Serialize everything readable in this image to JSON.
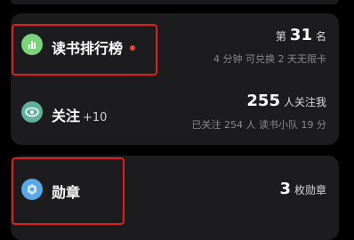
{
  "leaderboard": {
    "title": "读书排行榜",
    "rank_prefix": "第",
    "rank_value": "31",
    "rank_suffix": "名",
    "subtext": "4 分钟 可兑换 2 天无限卡",
    "accent_color": "#7bd47a",
    "icon": "bar-chart-icon"
  },
  "follow": {
    "title": "关注",
    "title_suffix": "+10",
    "followers_value": "255",
    "followers_suffix": "人关注我",
    "subtext": "已关注 254 人 读书小队 19 分",
    "accent_color": "#5fb39a",
    "icon": "eye-icon"
  },
  "badges": {
    "title": "勋章",
    "count_value": "3",
    "count_suffix": "枚勋章",
    "accent_color": "#5aa8e8",
    "icon": "medal-icon"
  },
  "colors": {
    "background": "#000000",
    "card": "#1c1c1e",
    "highlight": "#e01f1f",
    "notification_dot": "#e8483b"
  }
}
